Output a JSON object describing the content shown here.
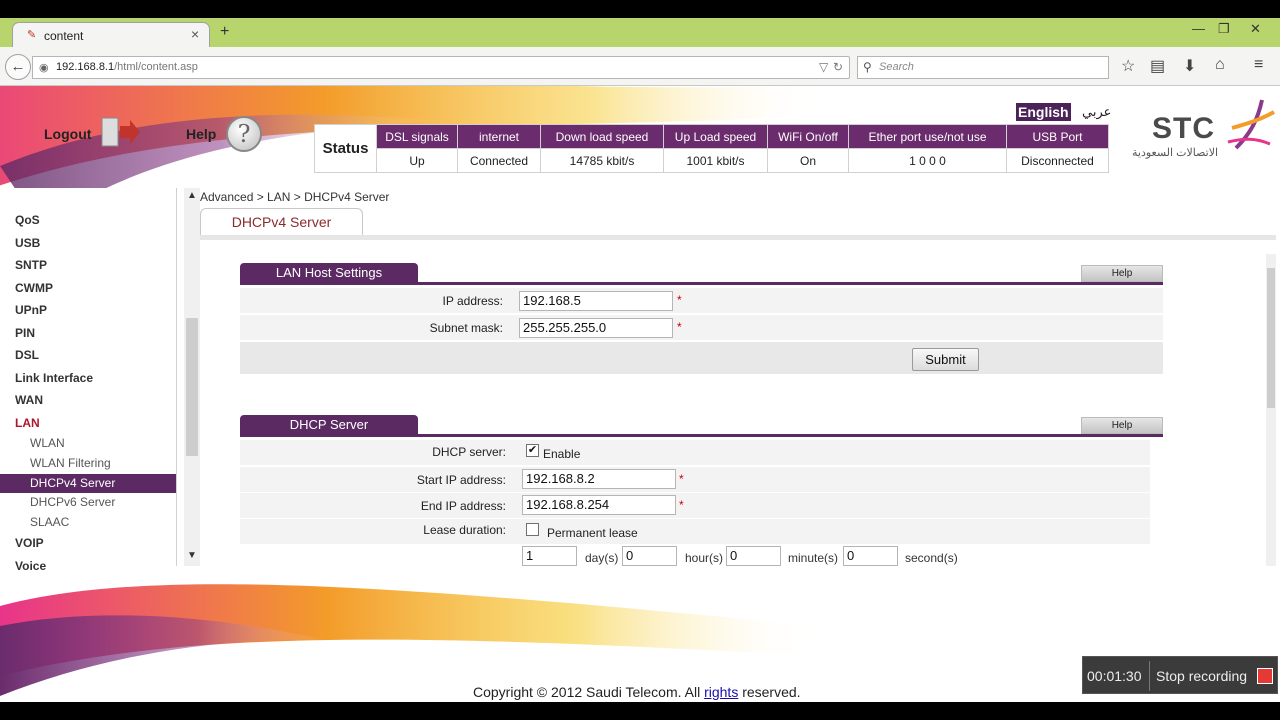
{
  "browser": {
    "tab_title": "content",
    "url_host": "192.168.8.1",
    "url_path": "/html/content.asp",
    "search_placeholder": "Search"
  },
  "header": {
    "logout": "Logout",
    "help": "Help",
    "lang_en": "English",
    "lang_ar": "عربي",
    "brand": "STC",
    "brand_ar": "الاتصالات السعودية"
  },
  "status": {
    "label": "Status",
    "headers": [
      "DSL signals",
      "internet",
      "Down load speed",
      "Up Load speed",
      "WiFi On/off",
      "Ether port use/not use",
      "USB Port"
    ],
    "values": [
      "Up",
      "Connected",
      "14785 kbit/s",
      "1001 kbit/s",
      "On",
      "1 0 0 0",
      "Disconnected"
    ]
  },
  "sidebar": {
    "items": [
      "QoS",
      "USB",
      "SNTP",
      "CWMP",
      "UPnP",
      "PIN",
      "DSL",
      "Link Interface",
      "WAN",
      "LAN",
      "WLAN",
      "WLAN Filtering",
      "DHCPv4 Server",
      "DHCPv6 Server",
      "SLAAC",
      "VOIP",
      "Voice"
    ]
  },
  "breadcrumb": "Advanced > LAN > DHCPv4 Server",
  "subtab": "DHCPv4 Server",
  "lan_host": {
    "title": "LAN Host Settings",
    "help": "Help",
    "ip_label": "IP address:",
    "ip_value": "192.168.5",
    "mask_label": "Subnet mask:",
    "mask_value": "255.255.255.0",
    "required": "*",
    "submit": "Submit"
  },
  "dhcp": {
    "title": "DHCP Server",
    "help": "Help",
    "server_label": "DHCP server:",
    "enable_label": "Enable",
    "enable_checked": "✔",
    "start_label": "Start IP address:",
    "start_value": "192.168.8.2",
    "end_label": "End IP address:",
    "end_value": "192.168.8.254",
    "lease_label": "Lease duration:",
    "permanent_label": "Permanent lease",
    "days": "1",
    "days_unit": "day(s)",
    "hours": "0",
    "hours_unit": "hour(s)",
    "minutes": "0",
    "minutes_unit": "minute(s)",
    "seconds": "0",
    "seconds_unit": "second(s)"
  },
  "footer": {
    "copy_pre": "Copyright © 2012 Saudi Telecom. All ",
    "copy_link": "rights",
    "copy_post": " reserved."
  },
  "recorder": {
    "time": "00:01:30",
    "stop": "Stop recording"
  },
  "colors": {
    "accent": "#5c2a63",
    "tabbar": "#b8d46c"
  }
}
